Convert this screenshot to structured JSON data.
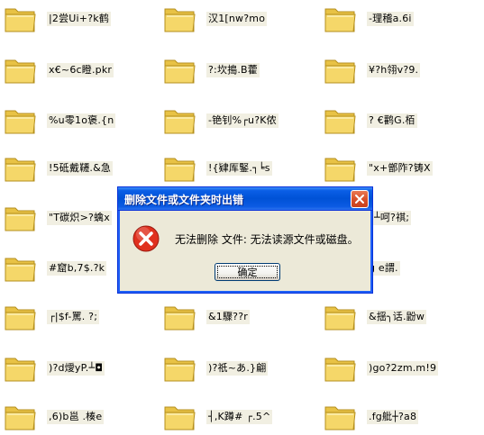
{
  "colors": {
    "folder_body": "#f5d769",
    "folder_tab": "#e8c245",
    "titlebar": "#0052d6",
    "dialog_bg": "#ece9d8",
    "error_red": "#e0301e"
  },
  "files": [
    {
      "name": "|2尝Ui+?k鹤",
      "icon": "folder-icon"
    },
    {
      "name": "汉1[nw?mo",
      "icon": "folder-icon"
    },
    {
      "name": "-理稽a.6i",
      "icon": "folder-icon"
    },
    {
      "name": "x€~6c瞪.pkr",
      "icon": "folder-icon"
    },
    {
      "name": "?:坎搗.B藿",
      "icon": "folder-icon"
    },
    {
      "name": "¥?h翎v?9.",
      "icon": "folder-icon"
    },
    {
      "name": "%u零1o褒.{n",
      "icon": "folder-icon"
    },
    {
      "name": "-铯钊%┌u?K侬",
      "icon": "folder-icon"
    },
    {
      "name": "?  €鹳G.栢",
      "icon": "folder-icon"
    },
    {
      "name": "!5砥戴韆.&急",
      "icon": "folder-icon"
    },
    {
      "name": "!{肄厍鋻.┐╘s",
      "icon": "folder-icon"
    },
    {
      "name": "\"x+鄫阼?铸X",
      "icon": "folder-icon"
    },
    {
      "name": "\"T碳炽>?蠄x",
      "icon": "folder-icon"
    },
    {
      "name": "",
      "icon": "folder-icon"
    },
    {
      "name": "?┴呵?祺;",
      "icon": "folder-icon"
    },
    {
      "name": "#窟b,7$.?k",
      "icon": "folder-icon"
    },
    {
      "name": "",
      "icon": "folder-icon"
    },
    {
      "name": "g  e謂.",
      "icon": "folder-icon"
    },
    {
      "name": "┌|$f-罵.  ?;",
      "icon": "folder-icon"
    },
    {
      "name": "&1驟??r",
      "icon": "folder-icon"
    },
    {
      "name": "&揺╮话.鼢w",
      "icon": "folder-icon"
    },
    {
      "name": ")?d燰yP.┴◘",
      "icon": "folder-icon"
    },
    {
      "name": ")?祇~あ.}翩",
      "icon": "folder-icon"
    },
    {
      "name": ")go?2zm.m!9",
      "icon": "folder-icon"
    },
    {
      "name": ",6)b邕  .楱e",
      "icon": "folder-icon"
    },
    {
      "name": "┤,K蹲#  ┌.5^",
      "icon": "folder-icon"
    },
    {
      "name": ".fg舭┼?a8",
      "icon": "folder-icon"
    }
  ],
  "dialog": {
    "title": "删除文件或文件夹时出错",
    "message": "无法删除 文件: 无法读源文件或磁盘。",
    "ok_label": "确定",
    "icon": "error-icon"
  }
}
